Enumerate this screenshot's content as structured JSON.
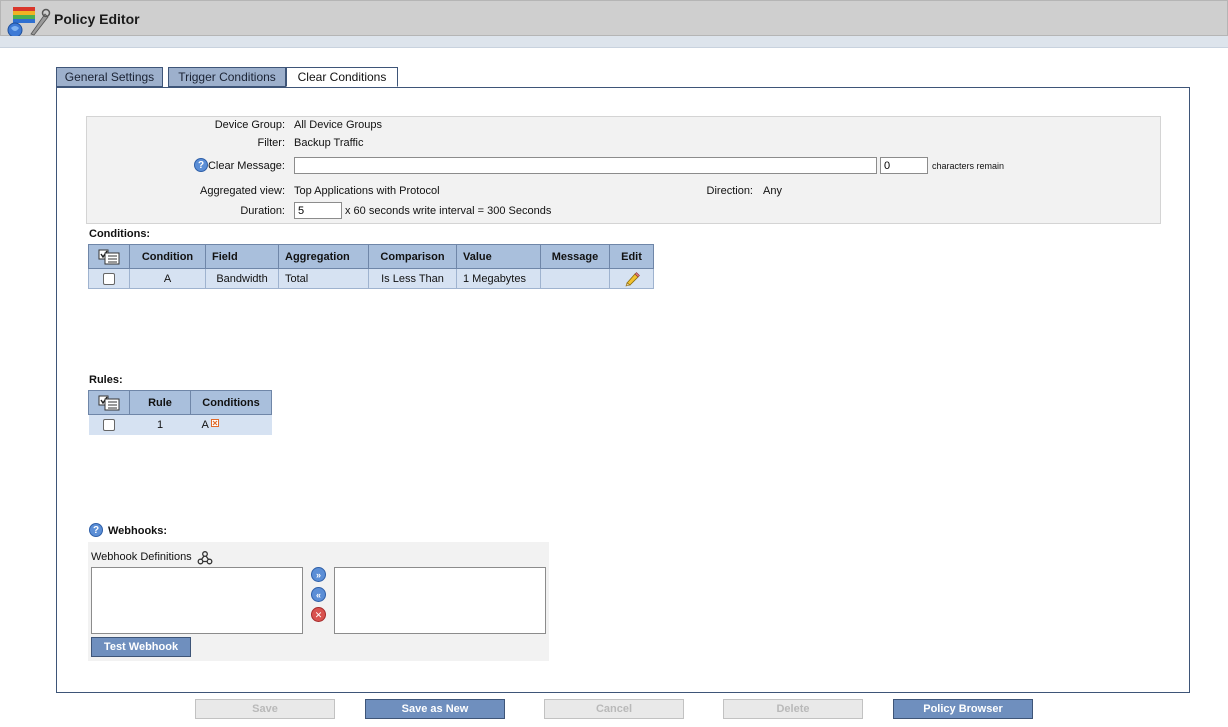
{
  "window": {
    "title": "Policy Editor"
  },
  "tabs": [
    {
      "label": "General Settings",
      "active": false
    },
    {
      "label": "Trigger Conditions",
      "active": false
    },
    {
      "label": "Clear Conditions",
      "active": true
    }
  ],
  "settings": {
    "device_group_label": "Device Group:",
    "device_group_value": "All Device Groups",
    "filter_label": "Filter:",
    "filter_value": "Backup Traffic",
    "clear_message_label": "Clear Message:",
    "clear_message_value": "",
    "chars_remaining_value": "0",
    "chars_remaining_text": "characters remain",
    "aggregated_view_label": "Aggregated view:",
    "aggregated_view_value": "Top Applications with Protocol",
    "direction_label": "Direction:",
    "direction_value": "Any",
    "duration_label": "Duration:",
    "duration_value": "5",
    "duration_suffix": "x 60 seconds write interval = 300 Seconds"
  },
  "conditions": {
    "title": "Conditions:",
    "columns": [
      "Condition",
      "Field",
      "Aggregation",
      "Comparison",
      "Value",
      "Message",
      "Edit"
    ],
    "rows": [
      {
        "condition": "A",
        "field": "Bandwidth",
        "aggregation": "Total",
        "comparison": "Is Less Than",
        "value": "1 Megabytes",
        "message": ""
      }
    ]
  },
  "rules": {
    "title": "Rules:",
    "columns": [
      "Rule",
      "Conditions"
    ],
    "rows": [
      {
        "rule": "1",
        "conditions": "A"
      }
    ]
  },
  "webhooks": {
    "title": "Webhooks:",
    "definitions_label": "Webhook Definitions",
    "test_button": "Test Webhook"
  },
  "footer": {
    "save": "Save",
    "save_as_new": "Save as New",
    "cancel": "Cancel",
    "delete": "Delete",
    "policy_browser": "Policy Browser"
  },
  "colors": {
    "tab_inactive": "#9db0cc",
    "table_header": "#a9bfdc",
    "table_row": "#d6e2f2",
    "button_enabled": "#6f8fbe",
    "help_icon": "#5b8ed6",
    "remove_icon": "#d9534f"
  },
  "icons": {
    "app_logo": "policy-editor-logo",
    "help": "help-icon",
    "select_all": "select-all-icon",
    "edit": "pencil-icon",
    "remove": "remove-x-icon",
    "webhook": "webhook-icon",
    "move_right": "double-arrow-right-icon",
    "move_left": "double-arrow-left-icon",
    "delete": "red-x-icon"
  }
}
